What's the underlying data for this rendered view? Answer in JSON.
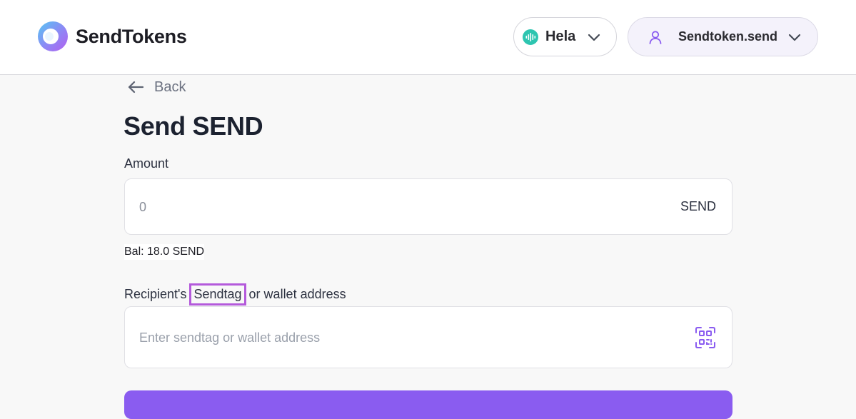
{
  "header": {
    "brand": "SendTokens",
    "network": {
      "label": "Hela"
    },
    "account": {
      "label": "Sendtoken.send"
    }
  },
  "nav": {
    "back_label": "Back"
  },
  "page": {
    "title": "Send SEND"
  },
  "amount": {
    "label": "Amount",
    "placeholder": "0",
    "token_suffix": "SEND",
    "balance": "Bal: 18.0 SEND"
  },
  "recipient": {
    "label_prefix": "Recipient's",
    "label_highlight": "Sendtag",
    "label_suffix": "or wallet address",
    "placeholder": "Enter sendtag or wallet address"
  },
  "colors": {
    "accent": "#8a5cf0",
    "highlight": "#b45adb",
    "network": "#2dc5b0"
  }
}
